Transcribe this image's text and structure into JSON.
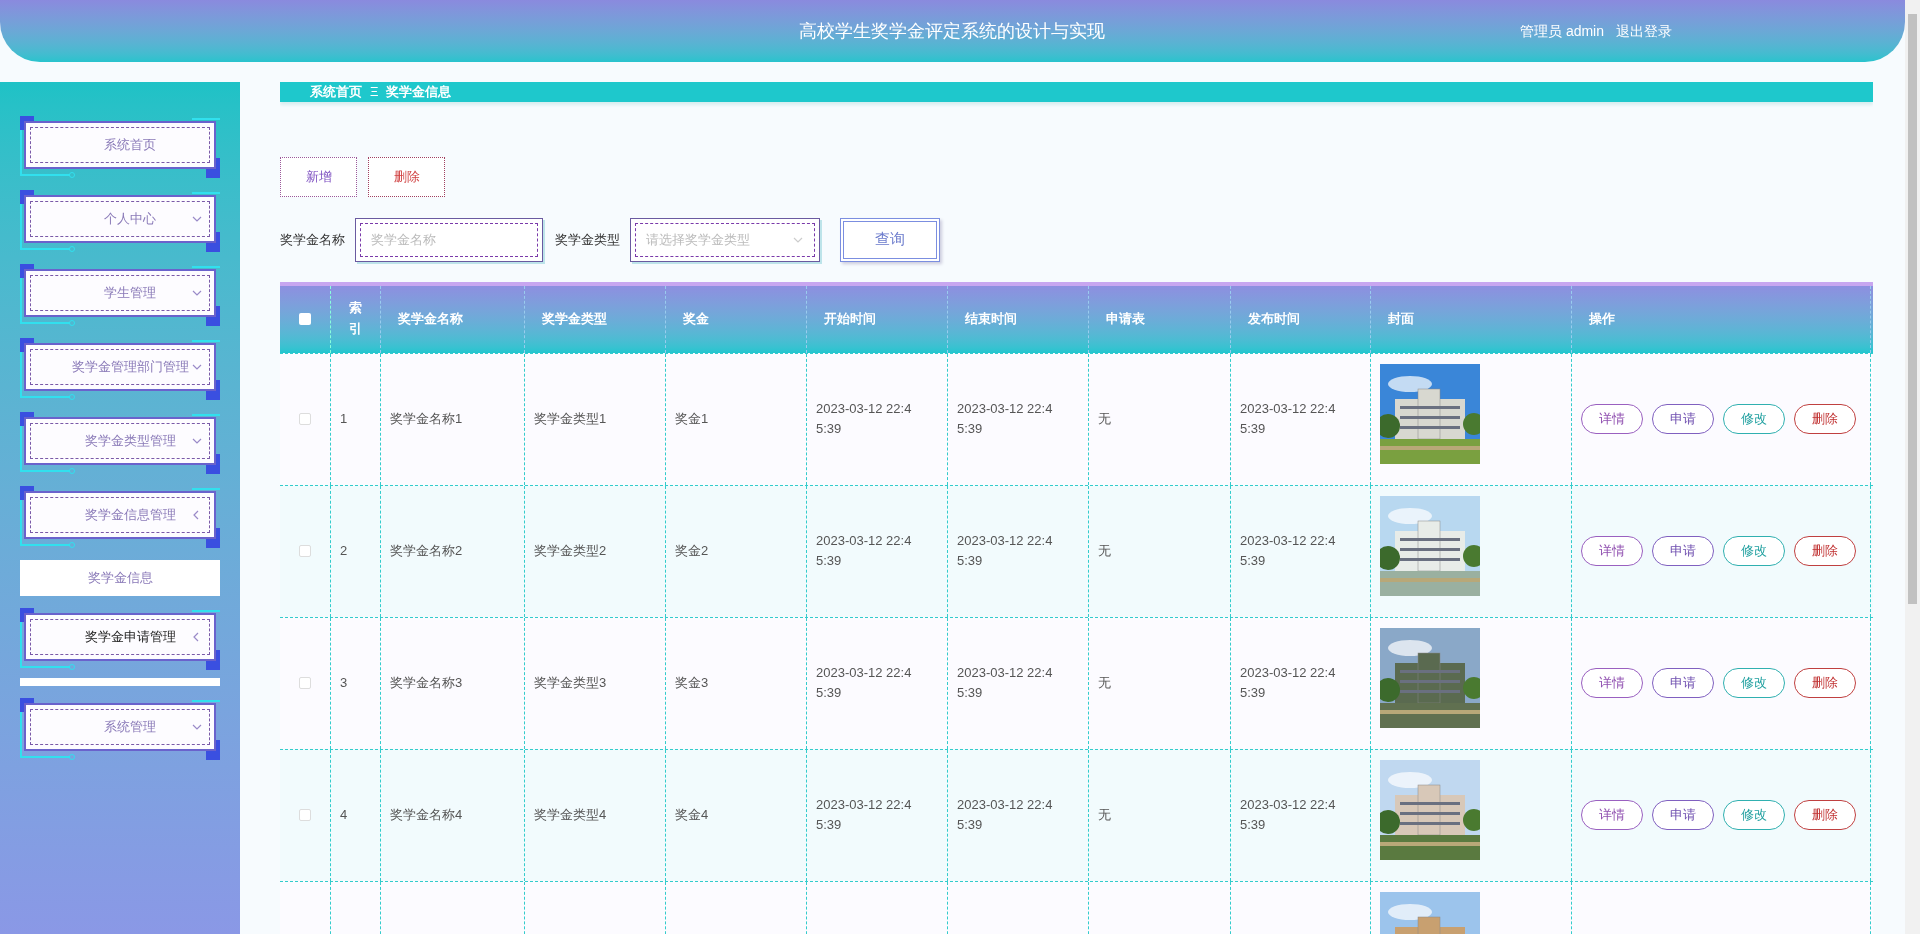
{
  "header": {
    "title": "高校学生奖学金评定系统的设计与实现",
    "user": "管理员 admin",
    "logout": "退出登录"
  },
  "sidebar": {
    "items": [
      {
        "label": "系统首页",
        "hovered": false
      },
      {
        "label": "个人中心",
        "expanded": false,
        "hovered": false
      },
      {
        "label": "学生管理",
        "expanded": false,
        "hovered": false
      },
      {
        "label": "奖学金管理部门管理",
        "expanded": false,
        "hovered": false
      },
      {
        "label": "奖学金类型管理",
        "expanded": false,
        "hovered": false
      },
      {
        "label": "奖学金信息管理",
        "expanded": true,
        "hovered": false,
        "children": [
          {
            "label": "奖学金信息",
            "selected": true
          }
        ]
      },
      {
        "label": "奖学金申请管理",
        "expanded": true,
        "hovered": true
      },
      {
        "label": "系统管理",
        "expanded": false,
        "hovered": false
      }
    ]
  },
  "breadcrumb": [
    "系统首页",
    "奖学金信息"
  ],
  "breadcrumb_separator": "Ξ",
  "toolbar": {
    "buttons": [
      {
        "label": "新增",
        "kind": "add"
      },
      {
        "label": "删除",
        "kind": "delete"
      }
    ]
  },
  "search": {
    "name_label": "奖学金名称",
    "name_placeholder": "奖学金名称",
    "type_label": "奖学金类型",
    "type_placeholder": "请选择奖学金类型",
    "button": "查询"
  },
  "table": {
    "select_all_checked": false,
    "columns": [
      "索引",
      "奖学金名称",
      "奖学金类型",
      "奖金",
      "开始时间",
      "结束时间",
      "申请表",
      "发布时间",
      "封面",
      "操作"
    ],
    "rows": [
      {
        "checked": false,
        "index": "1",
        "name": "奖学金名称1",
        "type": "奖学金类型1",
        "prize": "奖金1",
        "start": "2023-03-12 22:45:39",
        "end": "2023-03-12 22:45:39",
        "form": "无",
        "published": "2023-03-12 22:45:39",
        "cover": {
          "kind": "picture"
        },
        "actions": [
          "详情",
          "申请",
          "修改",
          "删除"
        ]
      },
      {
        "checked": false,
        "index": "2",
        "name": "奖学金名称2",
        "type": "奖学金类型2",
        "prize": "奖金2",
        "start": "2023-03-12 22:45:39",
        "end": "2023-03-12 22:45:39",
        "form": "无",
        "published": "2023-03-12 22:45:39",
        "cover": {
          "kind": "picture"
        },
        "actions": [
          "详情",
          "申请",
          "修改",
          "删除"
        ]
      },
      {
        "checked": false,
        "index": "3",
        "name": "奖学金名称3",
        "type": "奖学金类型3",
        "prize": "奖金3",
        "start": "2023-03-12 22:45:39",
        "end": "2023-03-12 22:45:39",
        "form": "无",
        "published": "2023-03-12 22:45:39",
        "cover": {
          "kind": "picture"
        },
        "actions": [
          "详情",
          "申请",
          "修改",
          "删除"
        ]
      },
      {
        "checked": false,
        "index": "4",
        "name": "奖学金名称4",
        "type": "奖学金类型4",
        "prize": "奖金4",
        "start": "2023-03-12 22:45:39",
        "end": "2023-03-12 22:45:39",
        "form": "无",
        "published": "2023-03-12 22:45:39",
        "cover": {
          "kind": "picture"
        },
        "actions": [
          "详情",
          "申请",
          "修改",
          "删除"
        ]
      },
      {
        "cover": {
          "kind": "picture"
        }
      }
    ]
  }
}
